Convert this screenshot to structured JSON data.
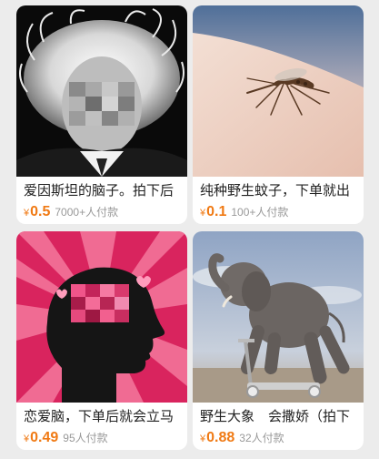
{
  "products": [
    {
      "title": "爱因斯坦的脑子。拍下后",
      "currency": "¥",
      "price": "0.5",
      "sold": "7000+人付款",
      "image_icon": "einstein-photo"
    },
    {
      "title": "纯种野生蚊子，下单就出",
      "currency": "¥",
      "price": "0.1",
      "sold": "100+人付款",
      "image_icon": "mosquito-photo"
    },
    {
      "title": "恋爱脑，下单后就会立马",
      "currency": "¥",
      "price": "0.49",
      "sold": "95人付款",
      "image_icon": "love-brain-illustration"
    },
    {
      "title": "野生大象　会撒娇（拍下",
      "currency": "¥",
      "price": "0.88",
      "sold": "32人付款",
      "image_icon": "elephant-on-scooter-photo"
    }
  ],
  "colors": {
    "price": "#f07a14",
    "sold": "#999999",
    "background": "#ececec"
  }
}
